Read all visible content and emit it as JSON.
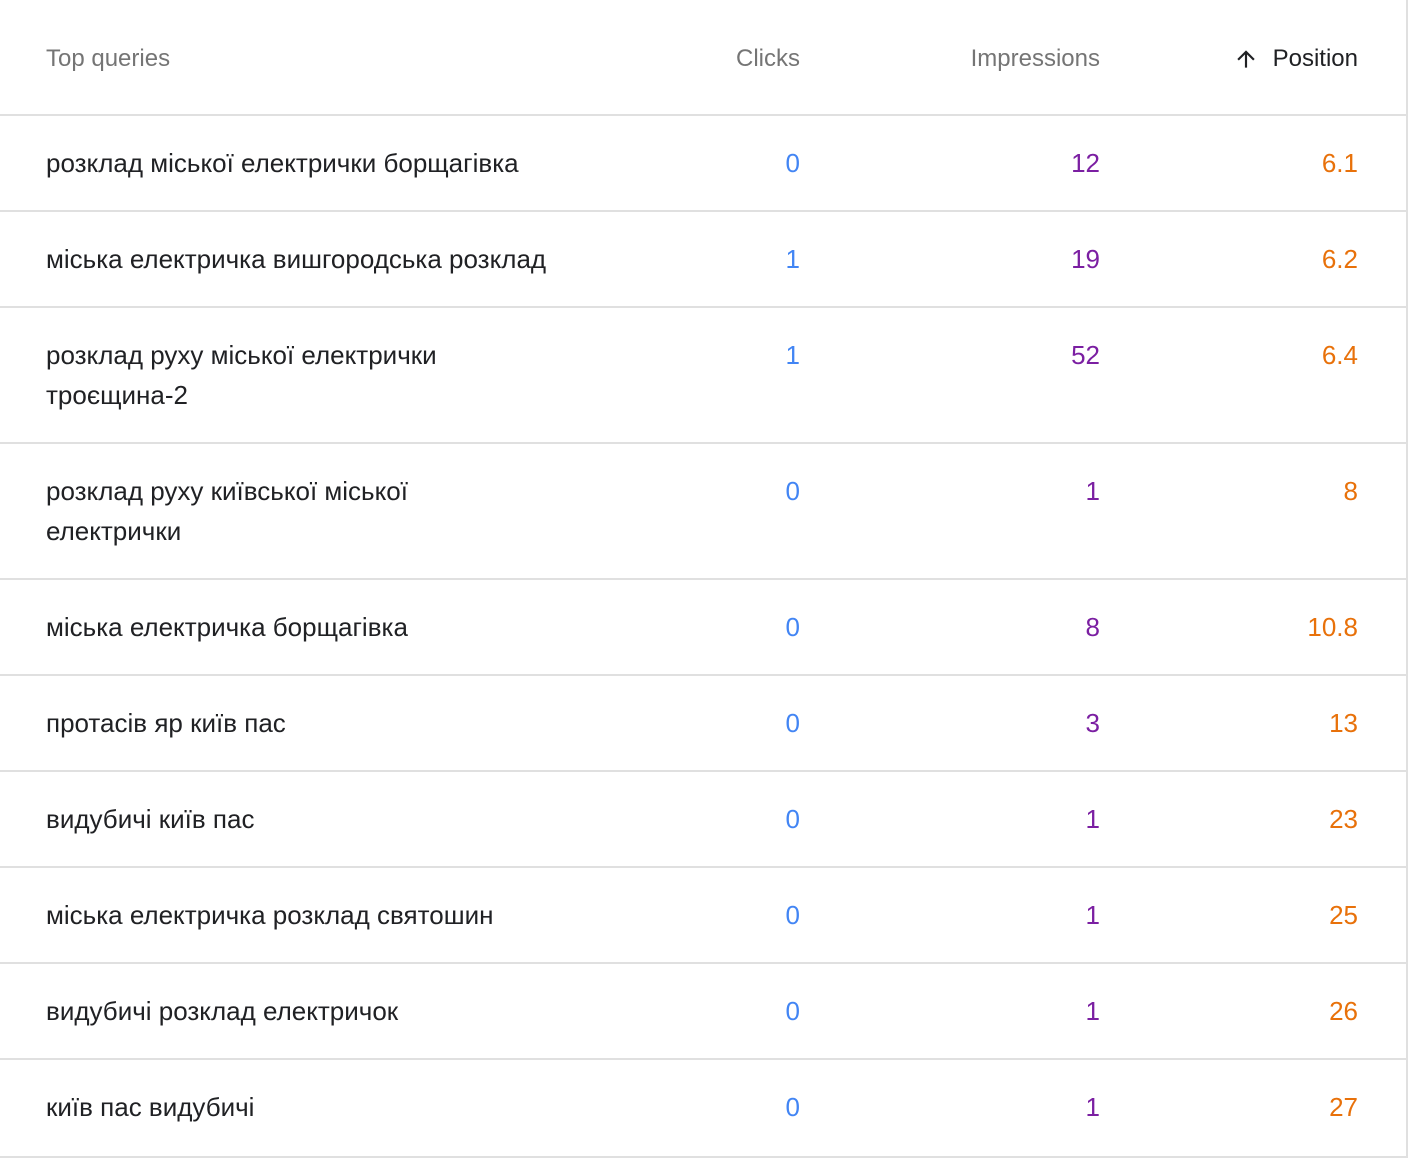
{
  "header": {
    "query_label": "Top queries",
    "clicks_label": "Clicks",
    "impressions_label": "Impressions",
    "position_label": "Position",
    "sort_icon": "arrow-up-icon"
  },
  "colors": {
    "clicks": "#4285f4",
    "impressions": "#7b1fa2",
    "position": "#e8710a",
    "header_text": "#757575",
    "divider": "#e0e0e0"
  },
  "rows": [
    {
      "query": "розклад міської електрички борщагівка",
      "clicks": "0",
      "impressions": "12",
      "position": "6.1"
    },
    {
      "query": "міська електричка вишгородська розклад",
      "clicks": "1",
      "impressions": "19",
      "position": "6.2"
    },
    {
      "query": "розклад руху міської електрички троєщина-2",
      "clicks": "1",
      "impressions": "52",
      "position": "6.4"
    },
    {
      "query": "розклад руху київської міської електрички",
      "clicks": "0",
      "impressions": "1",
      "position": "8"
    },
    {
      "query": "міська електричка борщагівка",
      "clicks": "0",
      "impressions": "8",
      "position": "10.8"
    },
    {
      "query": "протасів яр київ пас",
      "clicks": "0",
      "impressions": "3",
      "position": "13"
    },
    {
      "query": "видубичі київ пас",
      "clicks": "0",
      "impressions": "1",
      "position": "23"
    },
    {
      "query": "міська електричка розклад святошин",
      "clicks": "0",
      "impressions": "1",
      "position": "25"
    },
    {
      "query": "видубичі розклад електричок",
      "clicks": "0",
      "impressions": "1",
      "position": "26"
    },
    {
      "query": "київ пас видубичі",
      "clicks": "0",
      "impressions": "1",
      "position": "27"
    }
  ]
}
